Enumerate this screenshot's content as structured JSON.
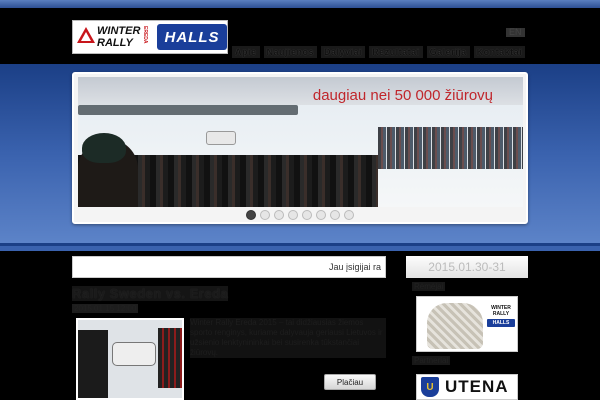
{
  "brand": {
    "winter_rally_line1": "WINTER",
    "winter_rally_line2": "RALLY",
    "winter_rally_sub": "EREDA",
    "sponsor": "HALLS"
  },
  "header": {
    "lang_label": "EN",
    "nav": [
      "Apie",
      "Naujienos",
      "Dalyviai",
      "Rezultatai",
      "Galerija",
      "Kontaktai"
    ]
  },
  "slider": {
    "caption": "daugiau nei 50 000 žiūrovų",
    "slide_count": 8,
    "active_slide": 1
  },
  "main": {
    "login_text": "Jau įsigijai ra",
    "post": {
      "title": "Rally Sweden vs. Ereda",
      "date": "2015.01.15 12:00",
      "excerpt": "Winter Rally Ereda 2015 – tai didžiausias žiemos sporto renginys, kuriame dalyvauja geriausi Lietuvos ir užsienio lenktynininkai bei susirenka tūkstančiai žiūrovų.",
      "more_label": "Plačiau"
    }
  },
  "sidebar": {
    "event_dates": "2015.01.30-31",
    "sponsor_label": "Rėmėjai",
    "partner_label": "Partneriai",
    "mini_logo": "WINTER RALLY",
    "mini_sponsor": "HALLS",
    "city_emblem": "U",
    "city": "UTENA"
  },
  "colors": {
    "band_dark": "#1b3f86",
    "band_light": "#5c83c8",
    "caption_red": "#c0262c",
    "halls_blue": "#1a3e9a"
  }
}
